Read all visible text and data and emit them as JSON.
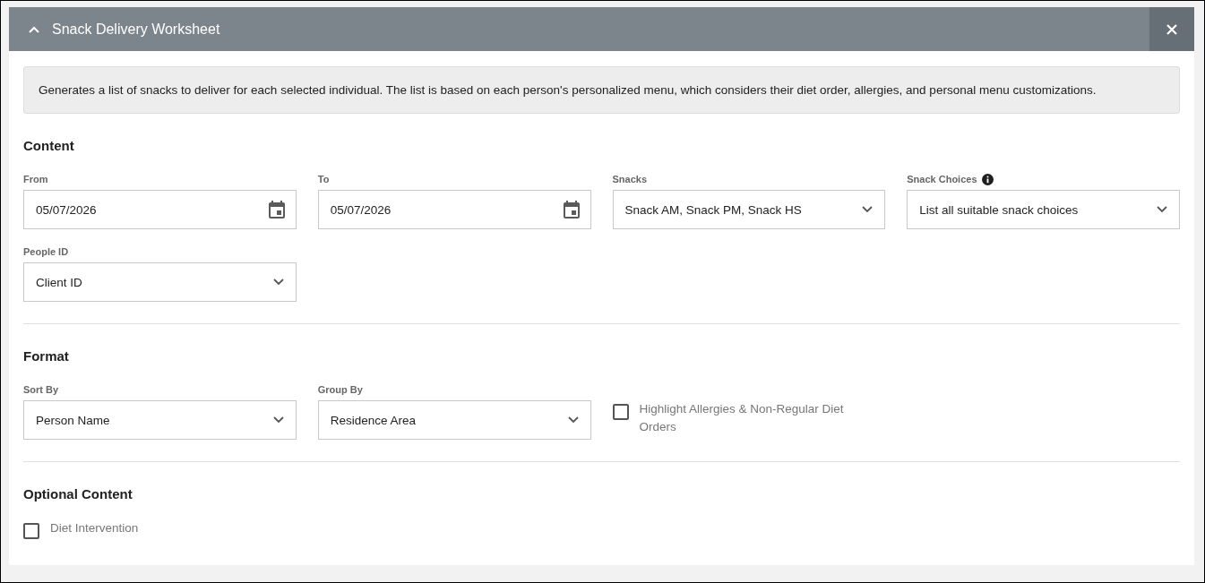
{
  "panel": {
    "title": "Snack Delivery Worksheet",
    "expanded": true
  },
  "description": "Generates a list of snacks to deliver for each selected individual. The list is based on each person's personalized menu, which considers their diet order, allergies, and personal menu customizations.",
  "sections": [
    {
      "heading": "Content",
      "fields": [
        {
          "kind": "date",
          "label": "From",
          "value": "05/07/2026"
        },
        {
          "kind": "date",
          "label": "To",
          "value": "05/07/2026"
        },
        {
          "kind": "select",
          "label": "Snacks",
          "value": "Snack AM, Snack PM, Snack HS"
        },
        {
          "kind": "select",
          "label": "Snack Choices",
          "info": true,
          "value": "List all suitable snack choices"
        },
        {
          "kind": "select",
          "label": "People ID",
          "value": "Client ID"
        }
      ]
    },
    {
      "heading": "Format",
      "fields": [
        {
          "kind": "select",
          "label": "Sort By",
          "value": "Person Name"
        },
        {
          "kind": "select",
          "label": "Group By",
          "value": "Residence Area"
        },
        {
          "kind": "checkbox",
          "label": "Highlight Allergies & Non-Regular Diet Orders",
          "checked": false
        }
      ]
    },
    {
      "heading": "Optional Content",
      "fields": [
        {
          "kind": "checkbox",
          "label": "Diet Intervention",
          "checked": false
        }
      ]
    }
  ]
}
